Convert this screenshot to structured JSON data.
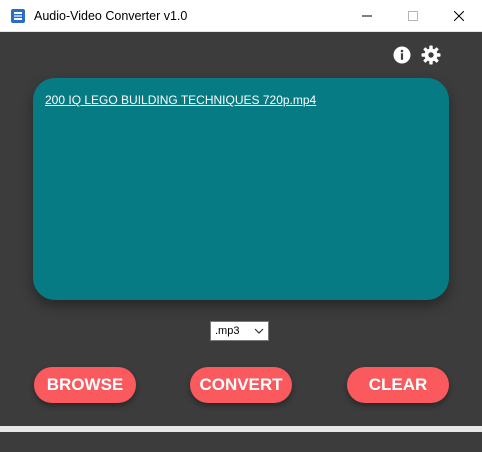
{
  "window": {
    "title": "Audio-Video Converter v1.0",
    "background_color": "#3c3c3c"
  },
  "titlebar": {
    "icon": "app-logo-icon",
    "minimize": "minimize-icon",
    "maximize": "maximize-icon",
    "close": "close-icon"
  },
  "toolbar": {
    "info_icon": "info-icon",
    "settings_icon": "gear-icon"
  },
  "file_panel": {
    "file_name": "200 IQ LEGO BUILDING TECHNIQUES  720p.mp4",
    "panel_color": "#077b84"
  },
  "format": {
    "selected": ".mp3"
  },
  "actions": {
    "browse_label": "BROWSE",
    "convert_label": "CONVERT",
    "clear_label": "CLEAR",
    "button_color": "#fa5a5e"
  }
}
